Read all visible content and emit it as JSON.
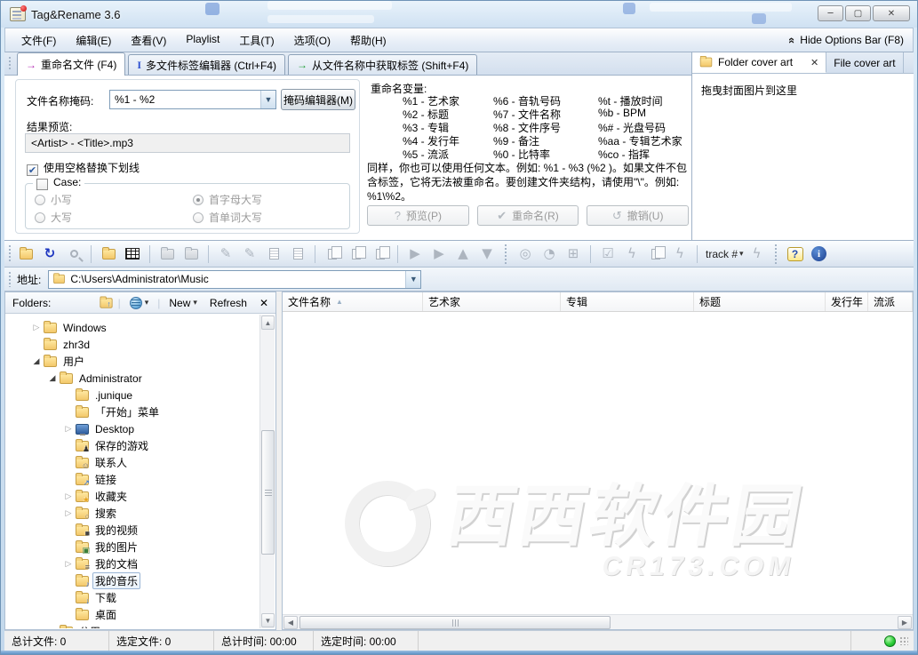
{
  "window": {
    "title": "Tag&Rename 3.6"
  },
  "menu": {
    "items": [
      "文件(F)",
      "编辑(E)",
      "查看(V)",
      "Playlist",
      "工具(T)",
      "选项(O)",
      "帮助(H)"
    ],
    "hide_options_label": "Hide Options Bar (F8)"
  },
  "tabs": [
    {
      "label": "重命名文件 (F4)",
      "active": true
    },
    {
      "label": "多文件标签编辑器 (Ctrl+F4)",
      "active": false
    },
    {
      "label": "从文件名称中获取标签 (Shift+F4)",
      "active": false
    }
  ],
  "cover_panel": {
    "tabs": [
      "Folder cover art",
      "File cover art"
    ],
    "active_tab": "Folder cover art",
    "drop_hint": "拖曳封面图片到这里"
  },
  "rename_panel": {
    "mask_label": "文件名称掩码:",
    "mask_value": "%1 - %2",
    "mask_editor_button": "掩码编辑器(M)",
    "preview_label": "结果预览:",
    "preview_value": "<Artist> - <Title>.mp3",
    "underscore_checkbox": "使用空格替换下划线",
    "underscore_checked": true,
    "case_group_label": "Case:",
    "case_options": [
      "小写",
      "大写",
      "首字母大写",
      "首单词大写"
    ],
    "case_selected": "首字母大写",
    "variables_title": "重命名变量:",
    "variables": [
      [
        "%1 - 艺术家",
        "%6 - 音轨号码",
        "%t - 播放时间"
      ],
      [
        "%2 - 标题",
        "%7 - 文件名称",
        "%b - BPM"
      ],
      [
        "%3 - 专辑",
        "%8 - 文件序号",
        "%# - 光盘号码"
      ],
      [
        "%4 - 发行年",
        "%9 - 备注",
        "%aa - 专辑艺术家"
      ],
      [
        "%5 - 流派",
        "%0 - 比特率",
        "%co - 指挥"
      ]
    ],
    "note": "同样，你也可以使用任何文本。例如: %1 - %3 (%2 )。如果文件不包含标签，它将无法被重命名。要创建文件夹结构，请使用\"\\\"。例如: %1\\%2。",
    "buttons": [
      {
        "label": "预览(P)",
        "icon": "question"
      },
      {
        "label": "重命名(R)",
        "icon": "check"
      },
      {
        "label": "撤销(U)",
        "icon": "undo"
      }
    ]
  },
  "toolbar": {
    "icons": [
      {
        "name": "open-folder",
        "kind": "cssfolder",
        "tone": "y",
        "enabled": true
      },
      {
        "name": "refresh",
        "kind": "glyph",
        "glyph": "↻",
        "color": "#1d36c0",
        "enabled": true
      },
      {
        "name": "search",
        "kind": "mag"
      },
      {
        "name": "sep"
      },
      {
        "name": "folder-tree-view",
        "kind": "cssfolder",
        "tone": "y",
        "enabled": true
      },
      {
        "name": "table-view",
        "kind": "grid",
        "enabled": true
      },
      {
        "name": "sep"
      },
      {
        "name": "folder-up",
        "kind": "cssfolder",
        "tone": "g"
      },
      {
        "name": "folder-new",
        "kind": "cssfolder",
        "tone": "g"
      },
      {
        "name": "sep"
      },
      {
        "name": "write-tags",
        "kind": "glyph",
        "glyph": "✎"
      },
      {
        "name": "write-tags-all",
        "kind": "glyph",
        "glyph": "✎"
      },
      {
        "name": "edit-tag",
        "kind": "page"
      },
      {
        "name": "tag-fields",
        "kind": "page"
      },
      {
        "name": "sep"
      },
      {
        "name": "copy-tag",
        "kind": "copy"
      },
      {
        "name": "paste-tag",
        "kind": "copy"
      },
      {
        "name": "paste-special",
        "kind": "copy"
      },
      {
        "name": "sep"
      },
      {
        "name": "play",
        "kind": "glyph",
        "glyph": "▶"
      },
      {
        "name": "play-next",
        "kind": "glyph",
        "glyph": "▶"
      },
      {
        "name": "move-up",
        "kind": "glyph",
        "glyph": "▲"
      },
      {
        "name": "move-down",
        "kind": "glyph",
        "glyph": "▼"
      },
      {
        "name": "bigsep"
      },
      {
        "name": "disc-lookup",
        "kind": "glyph",
        "glyph": "◎"
      },
      {
        "name": "online-lookup",
        "kind": "glyph",
        "glyph": "◔"
      },
      {
        "name": "calendar",
        "kind": "glyph",
        "glyph": "⊞"
      },
      {
        "name": "sep"
      },
      {
        "name": "quick-fix",
        "kind": "glyph",
        "glyph": "☑"
      },
      {
        "name": "auto-tag",
        "kind": "glyph",
        "glyph": "ϟ"
      },
      {
        "name": "multi-edit",
        "kind": "copy"
      },
      {
        "name": "auto-fix",
        "kind": "glyph",
        "glyph": "ϟ"
      },
      {
        "name": "sep"
      },
      {
        "name": "track-number",
        "kind": "track",
        "label": "track #"
      },
      {
        "name": "auto-number",
        "kind": "glyph",
        "glyph": "ϟ"
      },
      {
        "name": "bigsep"
      },
      {
        "name": "help",
        "kind": "help",
        "enabled": true
      },
      {
        "name": "about",
        "kind": "info",
        "enabled": true
      }
    ]
  },
  "address": {
    "label": "地址:",
    "value": "C:\\Users\\Administrator\\Music"
  },
  "folders_panel": {
    "title": "Folders:",
    "new_button": "New",
    "refresh_button": "Refresh"
  },
  "tree": {
    "items": [
      {
        "label": "Windows",
        "level": 0,
        "expand": "closed",
        "icon": "folder"
      },
      {
        "label": "zhr3d",
        "level": 0,
        "expand": "none",
        "icon": "folder"
      },
      {
        "label": "用户",
        "level": 0,
        "expand": "open",
        "icon": "folder"
      },
      {
        "label": "Administrator",
        "level": 1,
        "expand": "open",
        "icon": "folder"
      },
      {
        "label": ".junique",
        "level": 2,
        "expand": "none",
        "icon": "folder"
      },
      {
        "label": "「开始」菜单",
        "level": 2,
        "expand": "none",
        "icon": "folder"
      },
      {
        "label": "Desktop",
        "level": 2,
        "expand": "closed",
        "icon": "desktop"
      },
      {
        "label": "保存的游戏",
        "level": 2,
        "expand": "none",
        "icon": "games"
      },
      {
        "label": "联系人",
        "level": 2,
        "expand": "none",
        "icon": "contacts"
      },
      {
        "label": "链接",
        "level": 2,
        "expand": "none",
        "icon": "links"
      },
      {
        "label": "收藏夹",
        "level": 2,
        "expand": "closed",
        "icon": "favorites"
      },
      {
        "label": "搜索",
        "level": 2,
        "expand": "closed",
        "icon": "search"
      },
      {
        "label": "我的视频",
        "level": 2,
        "expand": "none",
        "icon": "video"
      },
      {
        "label": "我的图片",
        "level": 2,
        "expand": "none",
        "icon": "pictures"
      },
      {
        "label": "我的文档",
        "level": 2,
        "expand": "closed",
        "icon": "documents"
      },
      {
        "label": "我的音乐",
        "level": 2,
        "expand": "none",
        "icon": "music",
        "selected": true
      },
      {
        "label": "下载",
        "level": 2,
        "expand": "none",
        "icon": "downloads"
      },
      {
        "label": "桌面",
        "level": 2,
        "expand": "none",
        "icon": "folder"
      },
      {
        "label": "公用",
        "level": 1,
        "expand": "closed",
        "icon": "folder"
      }
    ]
  },
  "file_list": {
    "columns": [
      "文件名称",
      "艺术家",
      "专辑",
      "标题",
      "发行年",
      "流派"
    ],
    "sort_column": "文件名称",
    "sort_direction": "asc"
  },
  "watermark": {
    "text": "西西软件园",
    "subtext": "CR173.COM"
  },
  "status_bar": {
    "fields": [
      "总计文件: 0",
      "选定文件: 0",
      "总计时间: 00:00",
      "选定时间: 00:00"
    ]
  }
}
